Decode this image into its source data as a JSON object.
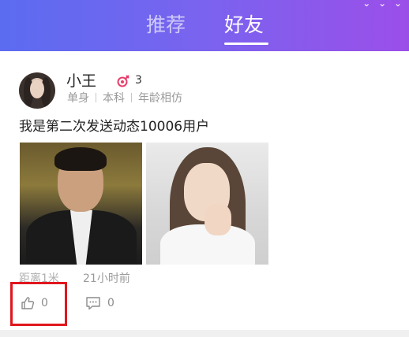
{
  "tabs": [
    {
      "label": "推荐",
      "active": false
    },
    {
      "label": "好友",
      "active": true
    }
  ],
  "post": {
    "user": {
      "name": "小王",
      "level": "3",
      "gender_icon": "gender-symbol-icon",
      "tags": [
        "单身",
        "本科",
        "年龄相仿"
      ]
    },
    "text": "我是第二次发送动态10006用户",
    "photos": [
      "man-in-suit-photo",
      "woman-portrait-photo"
    ],
    "distance": "距离1米",
    "time": "21小时前",
    "likes": "0",
    "comments": "0"
  },
  "colors": {
    "header_start": "#5b6cf0",
    "header_end": "#9b4fe9",
    "highlight": "#e0161e",
    "gender_icon": "#e83e6c"
  }
}
